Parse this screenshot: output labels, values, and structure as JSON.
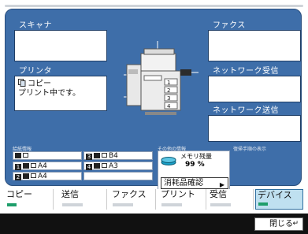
{
  "boxes": {
    "scanner": {
      "title": "スキャナ",
      "body": ""
    },
    "fax": {
      "title": "ファクス",
      "body": ""
    },
    "print": {
      "title": "プリンタ",
      "body_line1": "コピー",
      "body_line2": "プリント中です。"
    },
    "net_recv": {
      "title": "ネットワーク受信",
      "body": ""
    },
    "net_send": {
      "title": "ネットワーク送信",
      "body": ""
    }
  },
  "info": {
    "paper_label": "給紙情報",
    "other_label": "その他の情報",
    "recovery_label": "復帰手順の表示",
    "paper": [
      {
        "num": "",
        "size": ""
      },
      {
        "num": "3",
        "size": "B4"
      },
      {
        "num": "1",
        "size": "A4"
      },
      {
        "num": "4",
        "size": "A3"
      },
      {
        "num": "2",
        "size": "A4"
      },
      {
        "num": "",
        "size": ""
      }
    ],
    "memory_label": "メモリ残量",
    "memory_value": "99 %",
    "consumables_label": "消耗品確認"
  },
  "tabs": [
    {
      "label": "コピー",
      "active": false
    },
    {
      "label": "送信",
      "active": false
    },
    {
      "label": "ファクス",
      "active": false
    },
    {
      "label": "プリント",
      "active": false
    },
    {
      "label": "受信",
      "active": false
    },
    {
      "label": "デバイス",
      "active": true
    }
  ],
  "close_label": "閉じる",
  "colors": {
    "panel": "#3e6ea9",
    "active_tab": "#bfe0f0",
    "indicator": "#1e9e6b"
  }
}
